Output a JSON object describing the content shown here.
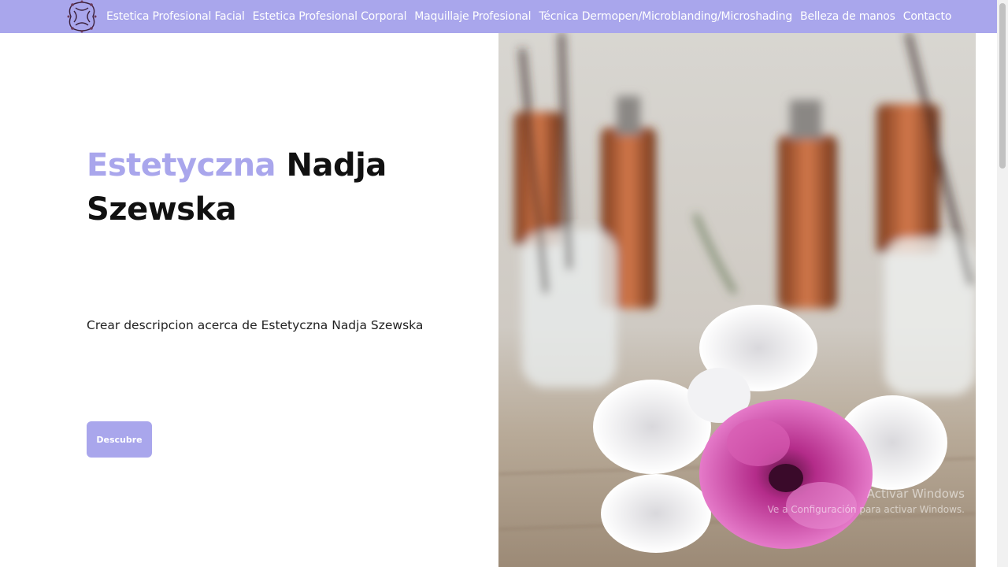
{
  "nav": {
    "items": [
      {
        "label": "Estetica Profesional Facial"
      },
      {
        "label": "Estetica Profesional Corporal"
      },
      {
        "label": "Maquillaje Profesional"
      },
      {
        "label": "Técnica Dermopen/Microblanding/Microshading"
      },
      {
        "label": "Belleza de manos"
      },
      {
        "label": "Contacto"
      }
    ]
  },
  "hero": {
    "title_accent": "Estetyczna",
    "title_rest": " Nadja Szewska",
    "description": "Crear descripcion acerca de Estetyczna Nadja Szewska",
    "button_label": "Descubre"
  },
  "watermark": {
    "line1": "Activar Windows",
    "line2": "Ve a Configuración para activar Windows."
  },
  "colors": {
    "accent": "#a9a6ec"
  }
}
